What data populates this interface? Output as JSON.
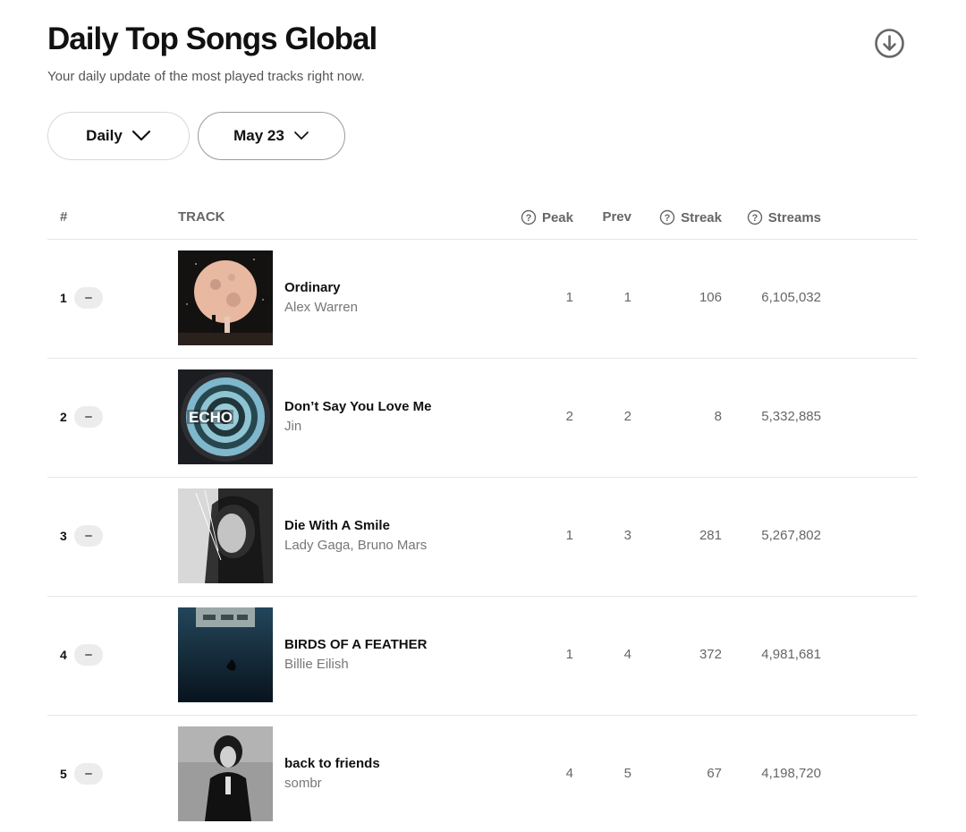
{
  "header": {
    "title": "Daily Top Songs Global",
    "subtitle": "Your daily update of the most played tracks right now."
  },
  "filters": {
    "period": "Daily",
    "date": "May 23"
  },
  "table": {
    "columns": {
      "rank": "#",
      "track": "TRACK",
      "peak": "Peak",
      "prev": "Prev",
      "streak": "Streak",
      "streams": "Streams"
    },
    "rows": [
      {
        "rank": "1",
        "song": "Ordinary",
        "artist": "Alex Warren",
        "peak": "1",
        "prev": "1",
        "streak": "106",
        "streams": "6,105,032"
      },
      {
        "rank": "2",
        "song": "Don’t Say You Love Me",
        "artist": "Jin",
        "peak": "2",
        "prev": "2",
        "streak": "8",
        "streams": "5,332,885"
      },
      {
        "rank": "3",
        "song": "Die With A Smile",
        "artist": "Lady Gaga, Bruno Mars",
        "peak": "1",
        "prev": "3",
        "streak": "281",
        "streams": "5,267,802"
      },
      {
        "rank": "4",
        "song": "BIRDS OF A FEATHER",
        "artist": "Billie Eilish",
        "peak": "1",
        "prev": "4",
        "streak": "372",
        "streams": "4,981,681"
      },
      {
        "rank": "5",
        "song": "back to friends",
        "artist": "sombr",
        "peak": "4",
        "prev": "5",
        "streak": "67",
        "streams": "4,198,720"
      }
    ]
  },
  "icons": {
    "download": "download-circle-icon",
    "chevron": "chevron-down-icon",
    "help": "question-circle-icon",
    "no_change": "minus-icon"
  }
}
